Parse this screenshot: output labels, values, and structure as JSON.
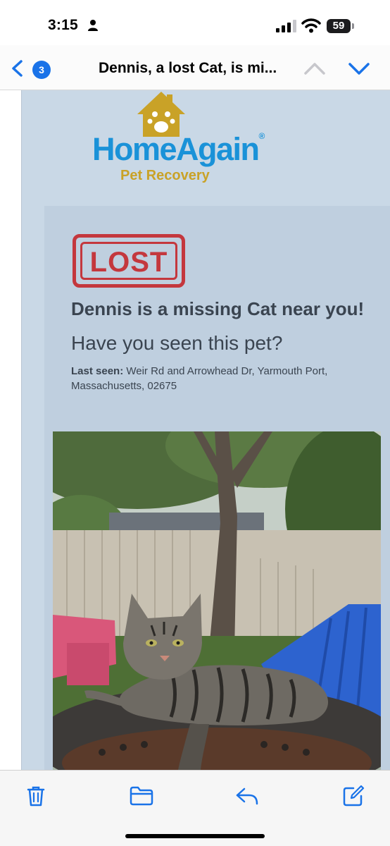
{
  "status_bar": {
    "time": "3:15",
    "battery": "59"
  },
  "nav": {
    "unread_count": "3",
    "title": "Dennis, a lost Cat, is mi..."
  },
  "email": {
    "logo": {
      "main": "HomeAgain",
      "registered": "®",
      "sub": "Pet Recovery"
    },
    "stamp": "LOST",
    "headline": "Dennis is a missing Cat near you!",
    "subhead": "Have you seen this pet?",
    "last_seen_label": "Last seen:",
    "last_seen_value": "Weir Rd and Arrowhead Dr, Yarmouth Port, Massachusetts, 02675"
  },
  "colors": {
    "accent": "#1a73e8",
    "logo_blue": "#1a92d8",
    "logo_gold": "#c9a227",
    "lost_red": "#c4373d",
    "email_bg": "#c9d8e6"
  },
  "toolbar": {
    "icons": [
      "trash-icon",
      "folder-icon",
      "reply-icon",
      "compose-icon"
    ]
  }
}
